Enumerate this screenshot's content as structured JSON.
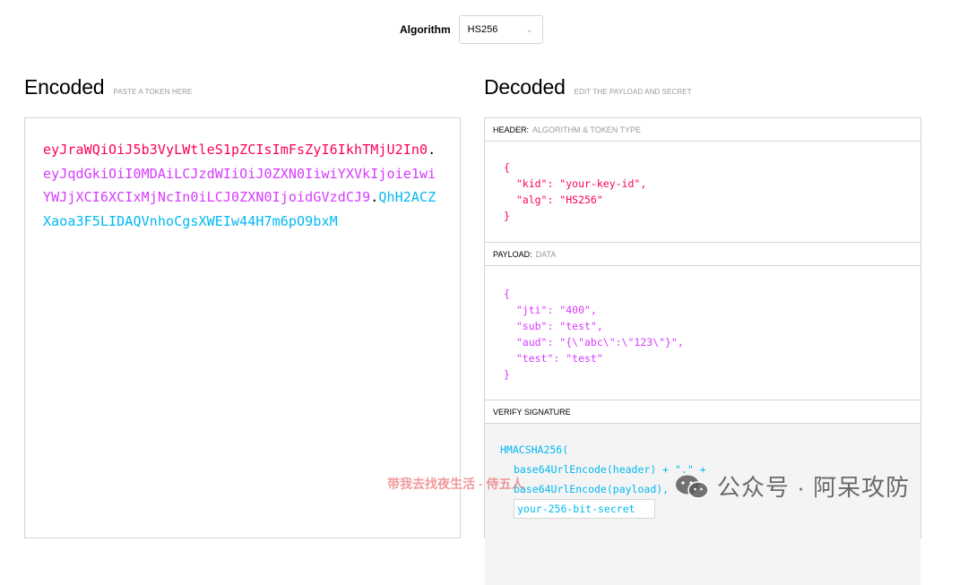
{
  "algorithm": {
    "label": "Algorithm",
    "selected": "HS256"
  },
  "encoded": {
    "title": "Encoded",
    "hint": "PASTE A TOKEN HERE",
    "token_header": "eyJraWQiOiJ5b3VyLWtleS1pZCIsImFsZyI6IkhTMjU2In0",
    "token_payload": "eyJqdGkiOiI0MDAiLCJzdWIiOiJ0ZXN0IiwiYXVkIjoie1wiYWJjXCI6XCIxMjNcIn0iLCJ0ZXN0IjoidGVzdCJ9",
    "token_signature": "QhH2ACZXaoa3F5LIDAQVnhoCgsXWEIw44H7m6pO9bxM",
    "dot": "."
  },
  "decoded": {
    "title": "Decoded",
    "hint": "EDIT THE PAYLOAD AND SECRET",
    "header_section": {
      "label": "HEADER:",
      "sub": "ALGORITHM & TOKEN TYPE"
    },
    "header_json": "{\n  \"kid\": \"your-key-id\",\n  \"alg\": \"HS256\"\n}",
    "payload_section": {
      "label": "PAYLOAD:",
      "sub": "DATA"
    },
    "payload_json": "{\n  \"jti\": \"400\",\n  \"sub\": \"test\",\n  \"aud\": \"{\\\"abc\\\":\\\"123\\\"}\",\n  \"test\": \"test\"\n}",
    "signature_section": {
      "label": "VERIFY SIGNATURE"
    },
    "signature": {
      "line1": "HMACSHA256(",
      "line2": "base64UrlEncode(header) + \".\" +",
      "line3": "base64UrlEncode(payload),",
      "secret_value": "your-256-bit-secret"
    }
  },
  "watermarks": {
    "red_text": "带我去找夜生活 - 侍五人",
    "wechat_text": "公众号 · 阿呆攻防"
  },
  "colors": {
    "header": "#fb015b",
    "payload": "#d63aff",
    "signature": "#00b9f1"
  }
}
